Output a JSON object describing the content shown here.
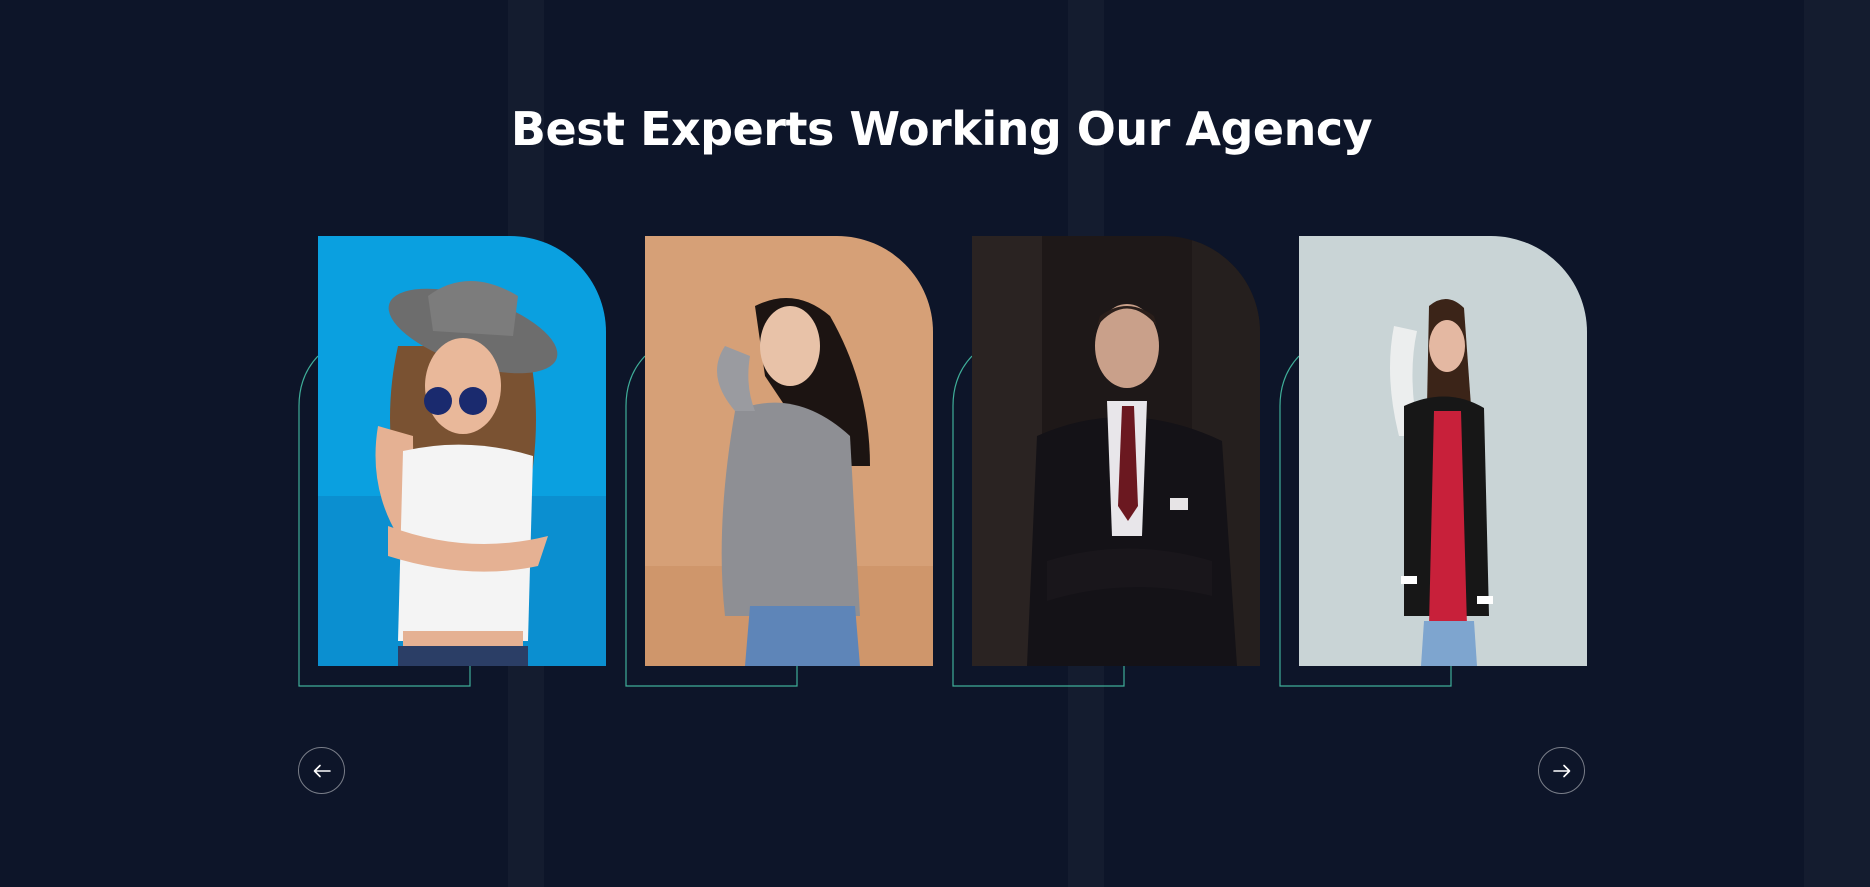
{
  "section": {
    "title": "Best Experts Working Our Agency"
  },
  "colors": {
    "background": "#0d1529",
    "accent_outline": "#3fae99",
    "title": "#ffffff"
  },
  "experts": [
    {
      "photo": "woman-hat-sunglasses-photo",
      "background": "#0aa0e0"
    },
    {
      "photo": "woman-plaid-blazer-photo",
      "background": "#d6a077"
    },
    {
      "photo": "man-dark-suit-photo",
      "background": "#1e1818"
    },
    {
      "photo": "woman-varsity-jacket-photo",
      "background": "#c9d4d6"
    }
  ],
  "navigation": {
    "prev_icon": "arrow-left-icon",
    "next_icon": "arrow-right-icon"
  }
}
